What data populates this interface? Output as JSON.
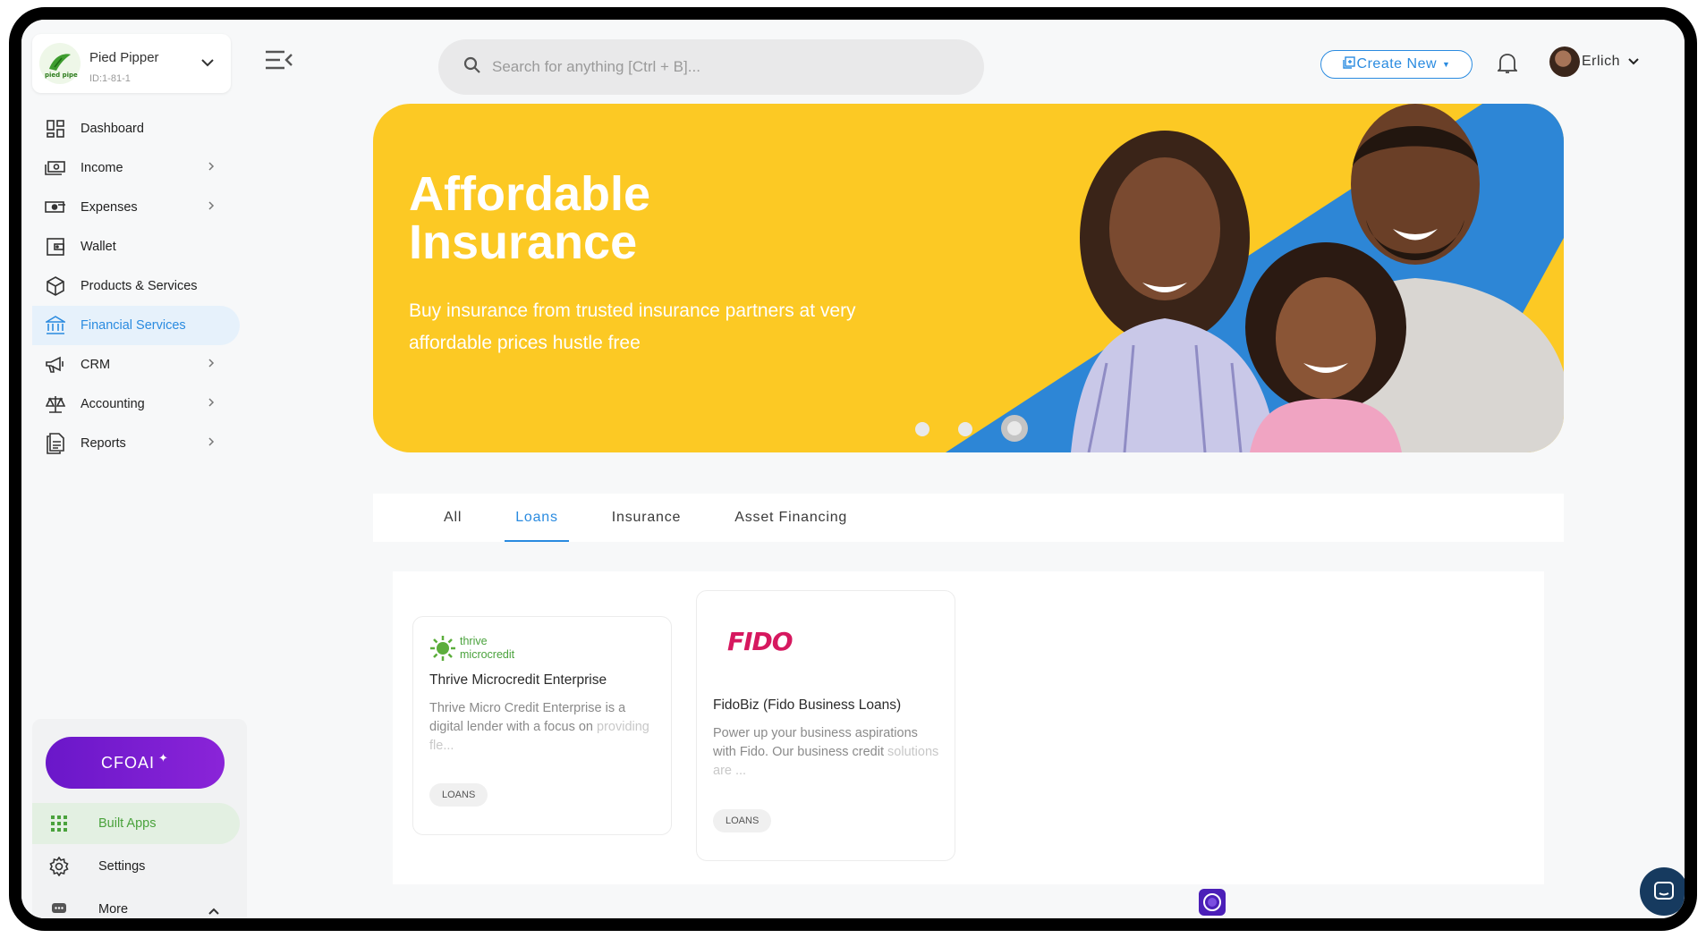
{
  "org": {
    "name": "Pied Pipper",
    "id": "ID:1-81-1",
    "logo_text": "pied piper"
  },
  "sidebar": {
    "items": [
      {
        "label": "Dashboard",
        "icon": "dashboard-icon",
        "has_arrow": false
      },
      {
        "label": "Income",
        "icon": "income-icon",
        "has_arrow": true
      },
      {
        "label": "Expenses",
        "icon": "expenses-icon",
        "has_arrow": true
      },
      {
        "label": "Wallet",
        "icon": "wallet-icon",
        "has_arrow": false
      },
      {
        "label": "Products & Services",
        "icon": "box-icon",
        "has_arrow": false
      },
      {
        "label": "Financial Services",
        "icon": "bank-icon",
        "has_arrow": false,
        "active": true
      },
      {
        "label": "CRM",
        "icon": "megaphone-icon",
        "has_arrow": true
      },
      {
        "label": "Accounting",
        "icon": "scale-icon",
        "has_arrow": true
      },
      {
        "label": "Reports",
        "icon": "report-icon",
        "has_arrow": true
      }
    ]
  },
  "bottom": {
    "cfoai_label": "CFOAI",
    "built_apps_label": "Built Apps",
    "settings_label": "Settings",
    "more_label": "More"
  },
  "header": {
    "search_placeholder": "Search for anything [Ctrl + B]...",
    "create_label": "Create New",
    "user_name": "Erlich"
  },
  "banner": {
    "title_line1": "Affordable",
    "title_line2": "Insurance",
    "subtitle": "Buy insurance from trusted insurance partners at very affordable prices hustle free",
    "slide_count": 3,
    "active_slide": 3
  },
  "tabs": [
    {
      "label": "All",
      "active": false
    },
    {
      "label": "Loans",
      "active": true
    },
    {
      "label": "Insurance",
      "active": false
    },
    {
      "label": "Asset Financing",
      "active": false
    }
  ],
  "cards": [
    {
      "logo_line1": "thrive",
      "logo_line2": "microcredit",
      "name": "Thrive Microcredit Enterprise",
      "desc_main": "Thrive Micro Credit Enterprise is a digital lender with a focus on",
      "desc_fade": "providing fle...",
      "tag": "LOANS"
    },
    {
      "logo_text": "FIDO",
      "name": "FidoBiz (Fido Business Loans)",
      "desc_main": "Power up your business aspirations with Fido. Our business credit",
      "desc_fade": "solutions are ...",
      "tag": "LOANS"
    }
  ],
  "colors": {
    "accent": "#2a8be0",
    "banner": "#fcc924",
    "cfoai": "#6a17c9",
    "built_apps": "#4aa23c",
    "fido": "#d6185f"
  }
}
